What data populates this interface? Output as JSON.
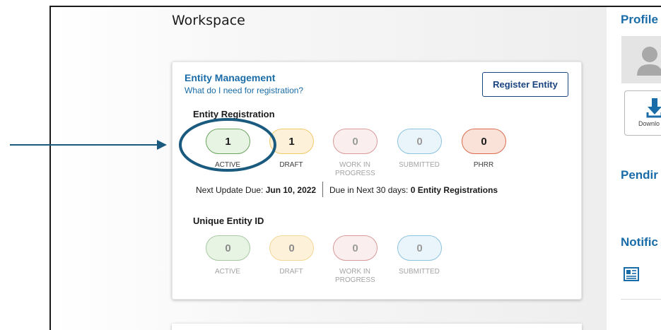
{
  "workspace": {
    "title": "Workspace"
  },
  "entity_management": {
    "title": "Entity Management",
    "link": "What do I need for registration?",
    "register_button": "Register Entity"
  },
  "entity_registration": {
    "title": "Entity Registration",
    "statuses": [
      {
        "count": "1",
        "label": "ACTIVE"
      },
      {
        "count": "1",
        "label": "DRAFT"
      },
      {
        "count": "0",
        "label": "WORK IN PROGRESS"
      },
      {
        "count": "0",
        "label": "SUBMITTED"
      },
      {
        "count": "0",
        "label": "PHRR"
      }
    ],
    "next_update_label": "Next Update Due: ",
    "next_update_date": "Jun 10, 2022",
    "due_next_label": "Due in Next 30 days: ",
    "due_next_value": "0 Entity Registrations"
  },
  "unique_entity_id": {
    "title": "Unique Entity ID",
    "statuses": [
      {
        "count": "0",
        "label": "ACTIVE"
      },
      {
        "count": "0",
        "label": "DRAFT"
      },
      {
        "count": "0",
        "label": "WORK IN PROGRESS"
      },
      {
        "count": "0",
        "label": "SUBMITTED"
      }
    ]
  },
  "sidebar": {
    "profile_title": "Profile",
    "download_label": "Downlo",
    "pending_title": "Pendir",
    "notifications_title": "Notific"
  },
  "colors": {
    "link_blue": "#1a6ca8",
    "button_navy": "#1a4480",
    "annotation_blue": "#1a5a7e"
  }
}
